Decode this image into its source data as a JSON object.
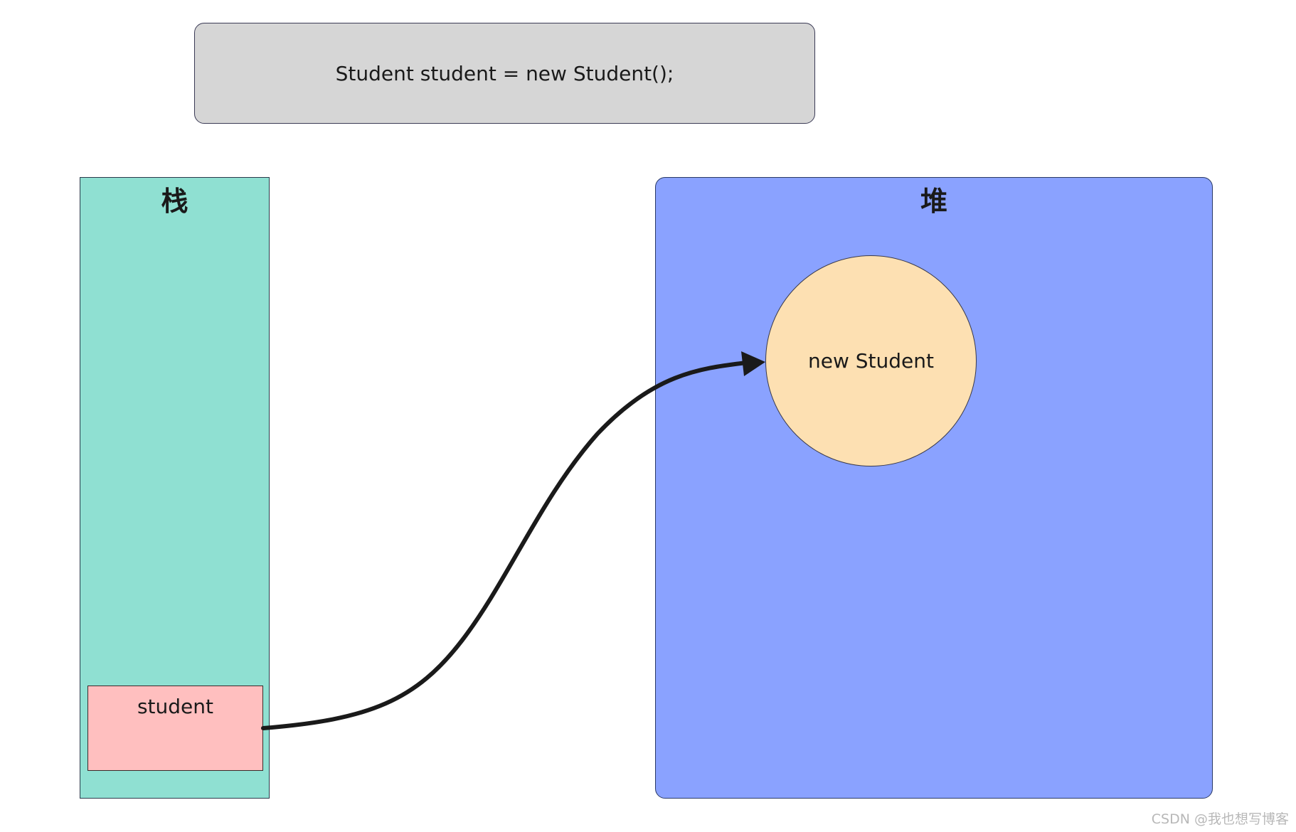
{
  "code": {
    "statement": "Student student = new Student();"
  },
  "stack": {
    "title": "栈",
    "variable": {
      "label": "student"
    }
  },
  "heap": {
    "title": "堆",
    "object": {
      "label": "new Student"
    }
  },
  "colors": {
    "code_box": "#d6d6d6",
    "stack": "#8fe0d2",
    "heap": "#8aa2ff",
    "variable": "#ffbfbf",
    "object": "#fde0b2",
    "arrow": "#1a1a1a"
  },
  "watermark": "CSDN @我也想写博客"
}
